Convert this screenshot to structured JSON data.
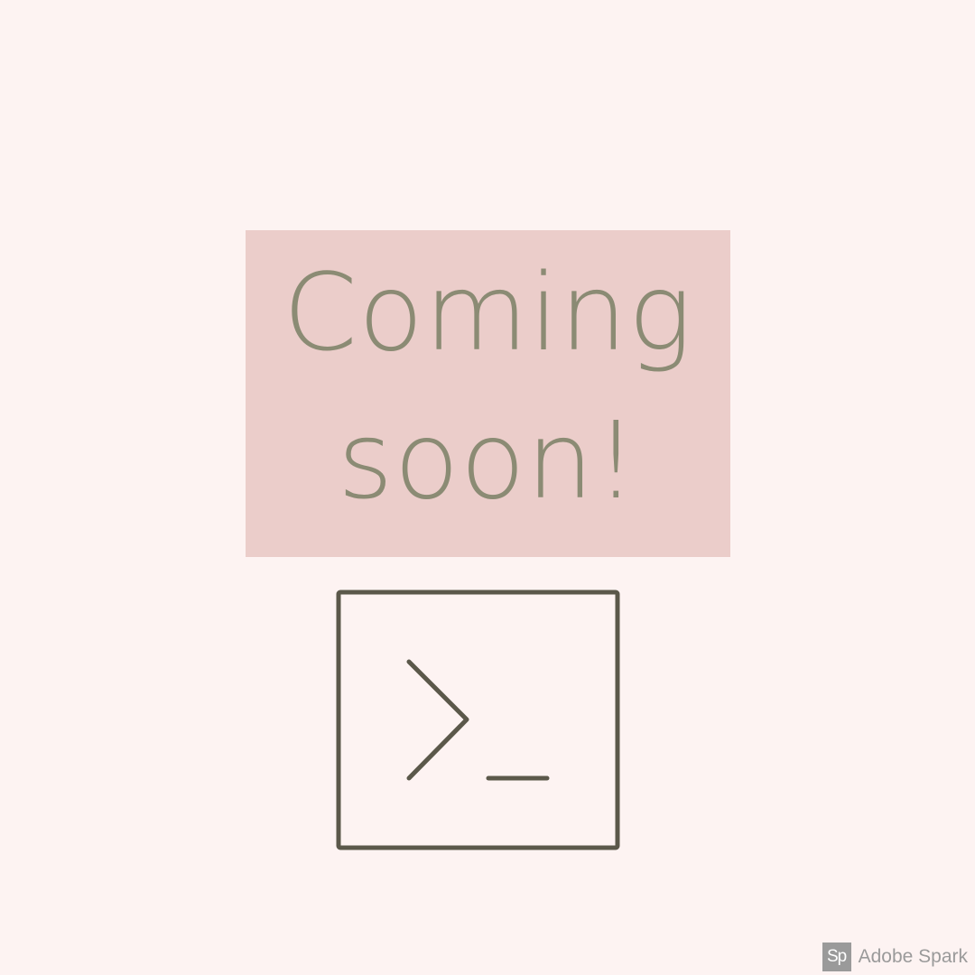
{
  "headline": {
    "line1": "Coming",
    "line2": "soon!"
  },
  "icon": {
    "name": "terminal-prompt-icon"
  },
  "watermark": {
    "badge": "Sp",
    "text": "Adobe Spark"
  },
  "colors": {
    "background": "#fdf3f2",
    "box": "#ebcdca",
    "text": "#8b8b74",
    "icon_stroke": "#5b584a",
    "watermark": "#9a9a9a"
  }
}
